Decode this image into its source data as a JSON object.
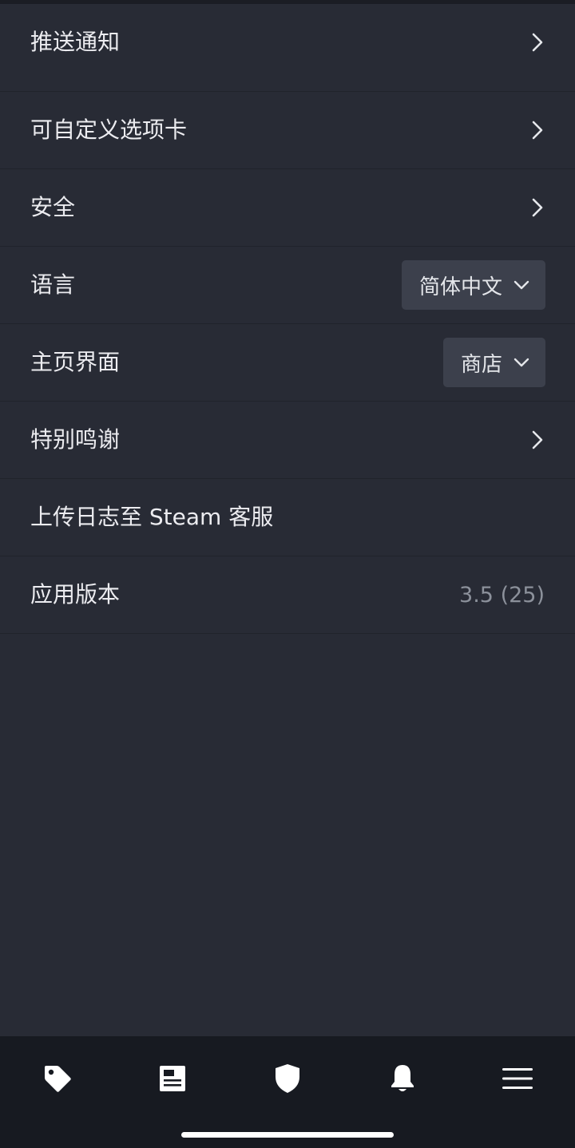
{
  "settings": {
    "items": [
      {
        "label": "推送通知"
      },
      {
        "label": "可自定义选项卡"
      },
      {
        "label": "安全"
      },
      {
        "label": "语言",
        "value": "简体中文"
      },
      {
        "label": "主页界面",
        "value": "商店"
      },
      {
        "label": "特别鸣谢"
      },
      {
        "label": "上传日志至 Steam 客服"
      },
      {
        "label": "应用版本",
        "value": "3.5 (25)"
      }
    ]
  },
  "tabbar": {
    "tabs": [
      {
        "icon": "tag-icon"
      },
      {
        "icon": "news-icon"
      },
      {
        "icon": "shield-icon"
      },
      {
        "icon": "bell-icon"
      },
      {
        "icon": "menu-icon"
      }
    ]
  },
  "colors": {
    "background": "#282b35",
    "tabbar": "#171a21",
    "dropdown": "#3c404c",
    "text": "#ececf0",
    "muted": "#8c919b"
  }
}
